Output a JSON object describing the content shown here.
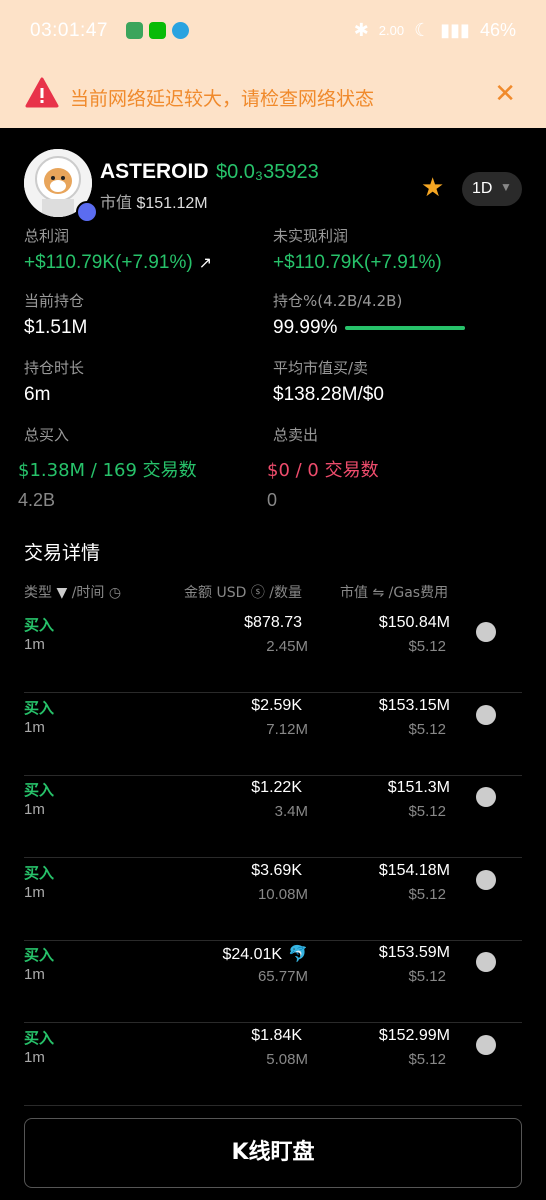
{
  "status": {
    "time": "03:01:47",
    "speed": "2.00",
    "battery": "46%"
  },
  "banner": {
    "message": "当前网络延迟较大，请检查网络状态",
    "close": "✕"
  },
  "token": {
    "name": "ASTEROID",
    "price": "$0.0†35923",
    "price_display": "$0.0₃35923",
    "mcap_label": "市值",
    "mcap_value": "$151.12M",
    "period": "1D"
  },
  "stats": {
    "total_profit": {
      "label": "总利润",
      "value": "+$110.79K(+7.91%)"
    },
    "unrealized": {
      "label": "未实现利润",
      "value": "+$110.79K(+7.91%)"
    },
    "holding": {
      "label": "当前持仓",
      "value": "$1.51M"
    },
    "holding_pct": {
      "label": "持仓%(4.2B/4.2B)",
      "value": "99.99%",
      "fraction": 0.9999
    },
    "duration": {
      "label": "持仓时长",
      "value": "6m"
    },
    "avg_mcap": {
      "label": "平均市值买/卖",
      "value": "$138.28M/$0"
    },
    "total_buy": {
      "label": "总买入",
      "value": "$1.38M / 169 交易数",
      "sub": "4.2B"
    },
    "total_sell": {
      "label": "总卖出",
      "value": "$0 / 0 交易数",
      "sub": "0"
    }
  },
  "trades": {
    "title": "交易详情",
    "headers": {
      "type": "类型",
      "time": "/时间",
      "amount": "金额 USD",
      "qty": "/数量",
      "mcap": "市值",
      "gas": "/Gas费用"
    },
    "rows": [
      {
        "type": "买入",
        "time": "1m",
        "amount": "$878.73",
        "qty": "2.45M",
        "mcap": "$150.84M",
        "gas": "$5.12"
      },
      {
        "type": "买入",
        "time": "1m",
        "amount": "$2.59K",
        "qty": "7.12M",
        "mcap": "$153.15M",
        "gas": "$5.12"
      },
      {
        "type": "买入",
        "time": "1m",
        "amount": "$1.22K",
        "qty": "3.4M",
        "mcap": "$151.3M",
        "gas": "$5.12"
      },
      {
        "type": "买入",
        "time": "1m",
        "amount": "$3.69K",
        "qty": "10.08M",
        "mcap": "$154.18M",
        "gas": "$5.12"
      },
      {
        "type": "买入",
        "time": "1m",
        "amount": "$24.01K",
        "qty": "65.77M",
        "mcap": "$153.59M",
        "gas": "$5.12"
      },
      {
        "type": "买入",
        "time": "1m",
        "amount": "$1.84K",
        "qty": "5.08M",
        "mcap": "$152.99M",
        "gas": "$5.12"
      }
    ]
  },
  "kline_button": "K线盯盘"
}
